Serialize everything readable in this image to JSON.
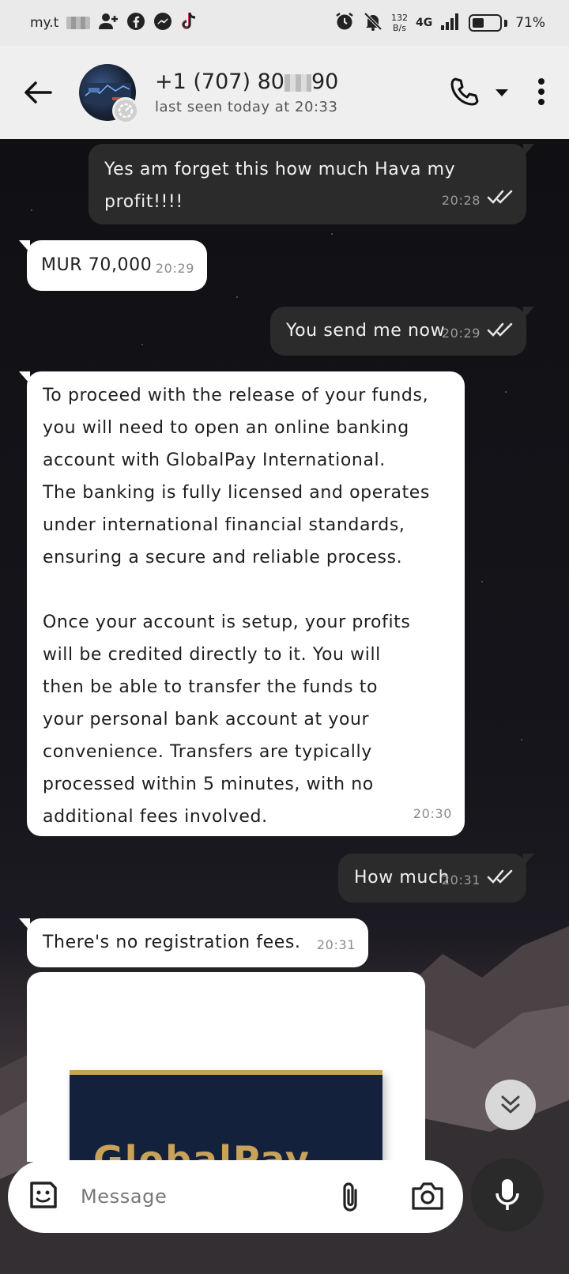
{
  "status_bar": {
    "carrier_prefix": "my.t",
    "speed_top": "132",
    "speed_bottom": "B/s",
    "network": "4G",
    "battery": "71%"
  },
  "header": {
    "contact_name": "+1 (707) 80",
    "contact_name_suffix": "90",
    "last_seen": "last seen today at 20:33"
  },
  "messages": [
    {
      "direction": "out",
      "text": "Yes am forget this how much Hava my\nprofit!!!!",
      "time": "20:28",
      "read": true
    },
    {
      "direction": "in",
      "text": "MUR 70,000",
      "time": "20:29"
    },
    {
      "direction": "out",
      "text": "You send me now",
      "time": "20:29",
      "read": true
    },
    {
      "direction": "in",
      "text": "To proceed with the release of your funds,\nyou will need to open an online banking\naccount with GlobalPay International.\nThe banking is fully licensed and operates\nunder international financial standards,\nensuring a secure and reliable process.\n\nOnce your account is setup, your profits\nwill be credited directly to it. You will\nthen be able to transfer the funds to\nyour personal bank account at your\nconvenience. Transfers are typically\nprocessed within 5 minutes, with no\nadditional fees involved.",
      "time": "20:30"
    },
    {
      "direction": "out",
      "text": "How much",
      "time": "20:31",
      "read": true
    },
    {
      "direction": "in",
      "text": "There's no registration fees.",
      "time": "20:31"
    }
  ],
  "image_preview": {
    "logo_text": "GlobalPay"
  },
  "compose": {
    "placeholder": "Message"
  },
  "colors": {
    "outgoing_bubble": "#2b2b2b",
    "incoming_bubble": "#ffffff",
    "header_bg": "#efefef",
    "logo_gold": "#c9a25a",
    "logo_navy": "#14213d"
  }
}
